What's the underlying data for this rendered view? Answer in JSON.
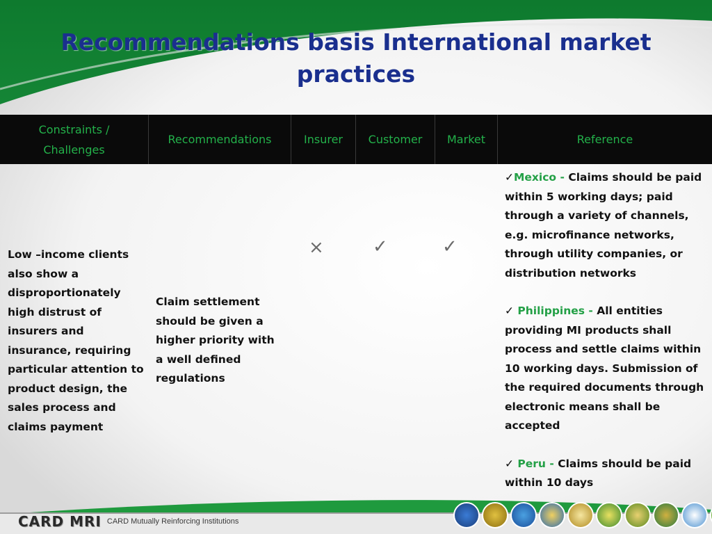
{
  "slide": {
    "title": "Recommendations basis International market practices"
  },
  "table": {
    "headers": {
      "constraints": "Constraints / Challenges",
      "recommendations": "Recommendations",
      "insurer": "Insurer",
      "customer": "Customer",
      "market": "Market",
      "reference": "Reference"
    },
    "row": {
      "constraint": "Low –income clients also show a disproportionately high distrust of insurers and insurance, requiring particular attention to product design, the sales process and claims payment",
      "recommendation": "Claim settlement should be given a higher priority with a well defined regulations",
      "insurer_mark": "×",
      "customer_mark": "✓",
      "market_mark": "✓",
      "references": [
        {
          "tick": "✓",
          "country": "Mexico - ",
          "text": "Claims should be paid within 5 working days; paid through a variety of channels, e.g. microfinance networks, through utility companies, or distribution networks"
        },
        {
          "tick": "✓",
          "country": "Philippines - ",
          "text": "All entities providing MI products shall process and settle claims within 10 working days. Submission of the required documents through electronic means shall be accepted"
        },
        {
          "tick": "✓",
          "country": "Peru - ",
          "text": "Claims should be paid within 10 days"
        }
      ]
    }
  },
  "footer": {
    "logo": "CARD MRI",
    "subtitle": "CARD Mutually Reinforcing Institutions"
  },
  "colors": {
    "title": "#1a2f8e",
    "header_text": "#23b14a",
    "header_bg": "#0a0a0a",
    "background_green": "#1f9a3e"
  }
}
